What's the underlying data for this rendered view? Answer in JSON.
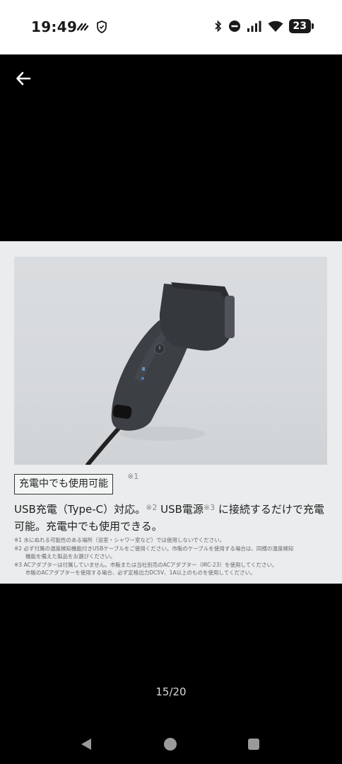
{
  "status_bar": {
    "time": "19:49",
    "battery": "23",
    "left_icons": [
      "data-saver-icon",
      "shield-icon"
    ],
    "right_icons": [
      "bluetooth-icon",
      "do-not-disturb-icon",
      "signal-icon",
      "wifi-icon",
      "battery-icon"
    ]
  },
  "viewer": {
    "back_icon": "arrow-left-icon",
    "page_counter": "15/20"
  },
  "card": {
    "tag": "充電中でも使用可能",
    "tag_note": "※1",
    "headline_a": "USB充電（Type-C）対応。",
    "headline_note_a": "※2",
    "headline_b": " USB電源",
    "headline_note_b": "※3",
    "headline_c": " に接続するだけで充電可能。充電中でも使用できる。",
    "footnote_1": "※1 水にぬれる可能性のある場所（浴室・シャワー室など）では使用しないでください。",
    "footnote_2a": "※2 必ず付属の温度検知機能付きUSBケーブルをご使用ください。市販のケーブルを使用する場合は、同様の温度検知",
    "footnote_2b": "機能を備えた製品をお選びください。",
    "footnote_3a": "※3 ACアダプターは付属していません。市販または当社別売のACアダプター（IRC-23）を使用してください。",
    "footnote_3b": "市販のACアダプターを使用する場合、必ず定格出力DC5V、1A以上のものを使用してください。"
  },
  "nav": {
    "back": "nav-back-icon",
    "home": "nav-home-icon",
    "recents": "nav-recents-icon"
  },
  "colors": {
    "card_bg": "#eaeced",
    "photo_bg": "#d6d9dc",
    "shaver_body": "#3a3d42"
  }
}
